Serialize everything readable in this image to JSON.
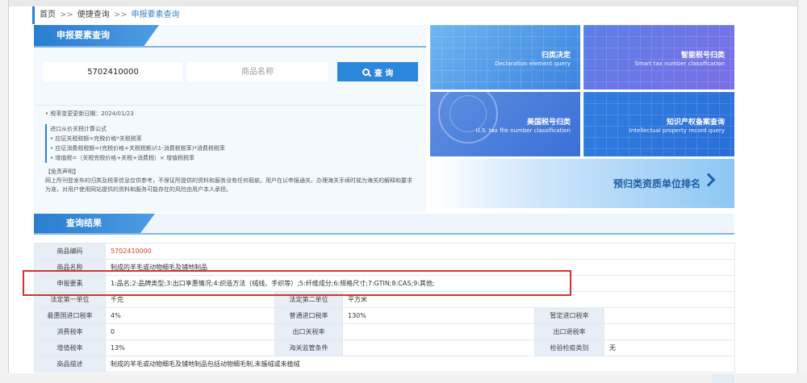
{
  "breadcrumb": {
    "home": "首页",
    "sep": ">>",
    "level2": "便捷查询",
    "current": "申报要素查询"
  },
  "query_panel": {
    "title": "申报要素查询",
    "code_value": "5702410000",
    "name_placeholder": "商品名称",
    "search_label": "查 询",
    "update_date": "• 税率变更更新日期：2024/01/23",
    "formula_title": "进口从价关税计算公式",
    "formulas": [
      "• 应征关税税额=完税价格*关税税率",
      "• 应征消费税税额=(完税价格+关税税额)/(1-消费税税率)*消费税税率",
      "• 增值税=（关税完税价格+关税+消费税）× 增值税税率"
    ],
    "disclaimer_title": "【免责声明】",
    "disclaimer_body": "网上所刊登发布的归类及税率信息仅供参考，不保证所提供的资料和服务没有任何瑕疵。用户在以申报通关、办理海关手续时视为海关的解释和要求为准，对用户使用网站提供的资料和服务可能存在的风险由用户本人承担。"
  },
  "tiles": [
    {
      "title": "归类决定",
      "subtitle": "Declaration element query"
    },
    {
      "title": "智能税号归类",
      "subtitle": "Smart tax number classification"
    },
    {
      "title": "美国税号归类",
      "subtitle": "U.S. tax file number classification"
    },
    {
      "title": "知识产权备案查询",
      "subtitle": "Intellectual property record query"
    },
    {
      "title": "预归类资质单位排名"
    }
  ],
  "results": {
    "title": "查询结果",
    "rows": [
      [
        {
          "t": "商品编码",
          "k": "lbl"
        },
        {
          "t": "5702410000",
          "k": "val red",
          "span": 5
        }
      ],
      [
        {
          "t": "商品名称",
          "k": "lbl"
        },
        {
          "t": "制成的羊毛或动物细毛及铺地制品",
          "k": "val",
          "span": 5
        }
      ],
      [
        {
          "t": "申报要素",
          "k": "lbl"
        },
        {
          "t": "1:品名;2:品牌类型;3:出口享惠情况;4:织造方法（绒线、手织等）;5:纤维成分;6:规格尺寸;7:GTIN;8:CAS;9:其他;",
          "k": "val",
          "span": 5
        }
      ],
      [
        {
          "t": "法定第一单位",
          "k": "lbl"
        },
        {
          "t": "千克",
          "k": "val"
        },
        {
          "t": "法定第二单位",
          "k": "lbl"
        },
        {
          "t": "平方米",
          "k": "val",
          "span": 3
        }
      ],
      [
        {
          "t": "最惠国进口税率",
          "k": "lbl"
        },
        {
          "t": "4%",
          "k": "val"
        },
        {
          "t": "普通进口税率",
          "k": "lbl"
        },
        {
          "t": "130%",
          "k": "val"
        },
        {
          "t": "暂定进口税率",
          "k": "lbl"
        },
        {
          "t": "",
          "k": "val"
        }
      ],
      [
        {
          "t": "消费税率",
          "k": "lbl"
        },
        {
          "t": "0",
          "k": "val"
        },
        {
          "t": "出口关税率",
          "k": "lbl"
        },
        {
          "t": "",
          "k": "val"
        },
        {
          "t": "出口退税率",
          "k": "lbl"
        },
        {
          "t": "",
          "k": "val"
        }
      ],
      [
        {
          "t": "增值税率",
          "k": "lbl"
        },
        {
          "t": "13%",
          "k": "val"
        },
        {
          "t": "海关监管条件",
          "k": "lbl"
        },
        {
          "t": "",
          "k": "val"
        },
        {
          "t": "检验检疫类别",
          "k": "lbl"
        },
        {
          "t": "无",
          "k": "val"
        }
      ],
      [
        {
          "t": "商品描述",
          "k": "lbl"
        },
        {
          "t": "制成的羊毛或动物细毛及铺地制品包括动物细毛制,未簇绒或未植绒",
          "k": "val",
          "span": 5
        }
      ]
    ]
  }
}
